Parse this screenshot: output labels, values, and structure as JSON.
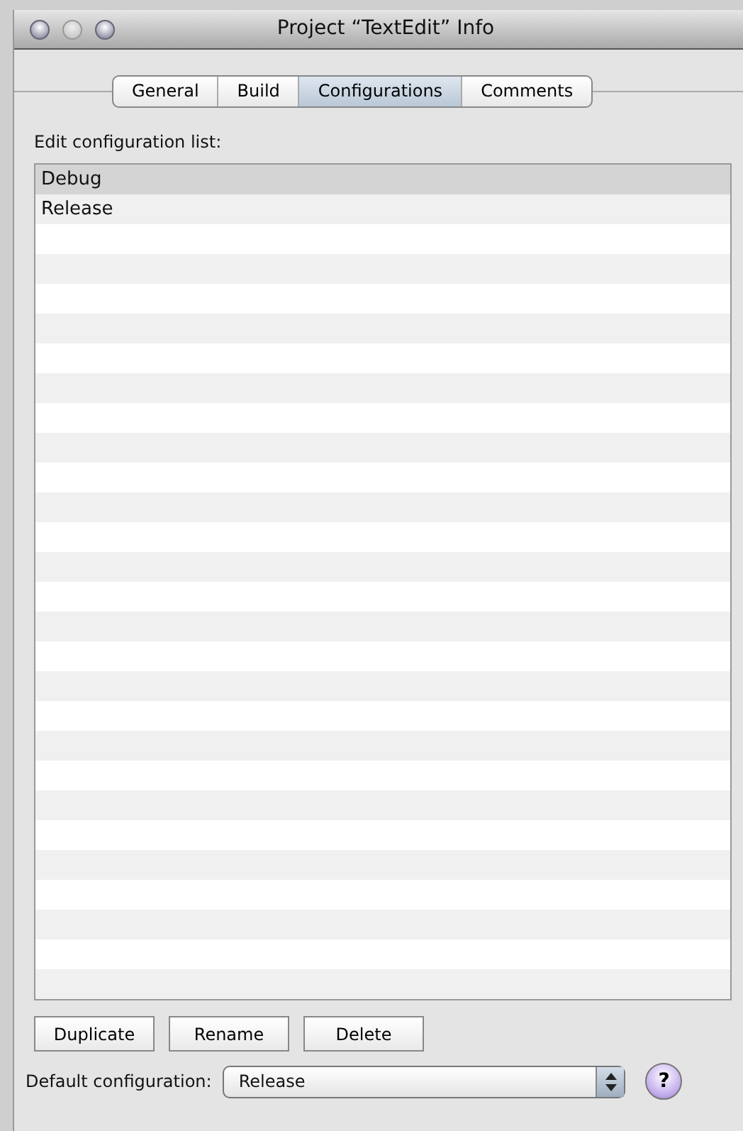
{
  "window": {
    "title": "Project “TextEdit” Info"
  },
  "tabs": [
    {
      "label": "General",
      "selected": false
    },
    {
      "label": "Build",
      "selected": false
    },
    {
      "label": "Configurations",
      "selected": true
    },
    {
      "label": "Comments",
      "selected": false
    }
  ],
  "list_label": "Edit configuration list:",
  "configurations": [
    {
      "name": "Debug",
      "selected": true
    },
    {
      "name": "Release",
      "selected": false
    }
  ],
  "buttons": [
    "Duplicate",
    "Rename",
    "Delete"
  ],
  "default_configuration": {
    "label": "Default configuration:",
    "value": "Release"
  },
  "help_button": "?"
}
